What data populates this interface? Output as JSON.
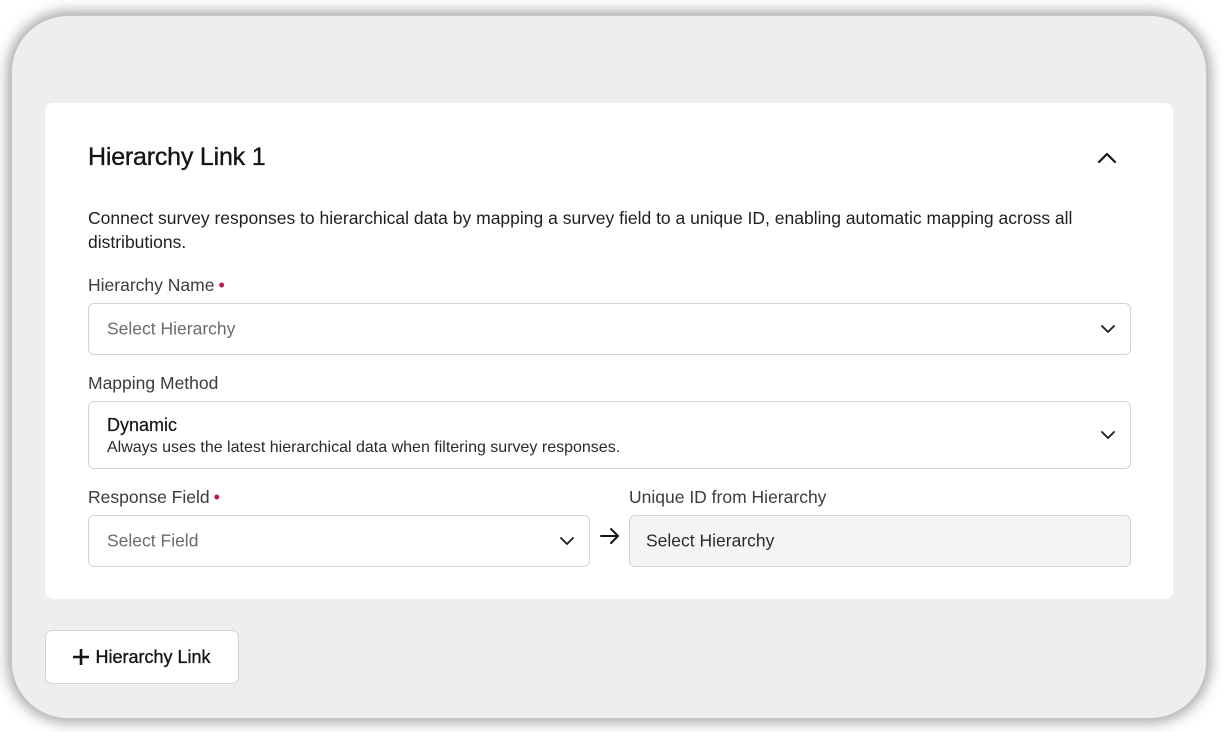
{
  "card": {
    "title": "Hierarchy Link 1",
    "description": "Connect survey responses to hierarchical data by mapping a survey field to a unique ID, enabling automatic mapping across all distributions."
  },
  "hierarchy_name": {
    "label": "Hierarchy Name",
    "required_marker": "•",
    "placeholder": "Select Hierarchy"
  },
  "mapping_method": {
    "label": "Mapping Method",
    "selected_title": "Dynamic",
    "selected_description": "Always uses the latest hierarchical data when filtering survey responses."
  },
  "response_field": {
    "label": "Response Field",
    "required_marker": "•",
    "placeholder": "Select Field"
  },
  "unique_id": {
    "label": "Unique ID from Hierarchy",
    "value": "Select Hierarchy"
  },
  "add_button": {
    "label": "Hierarchy Link"
  },
  "icons": {
    "collapse": "chevron-up-icon",
    "dropdown": "chevron-down-icon",
    "arrow": "arrow-right-icon",
    "add": "plus-icon"
  },
  "colors": {
    "required": "#c4174f",
    "background": "#eceef0",
    "card": "#ffffff",
    "readonly_field": "#f3f4f5"
  }
}
